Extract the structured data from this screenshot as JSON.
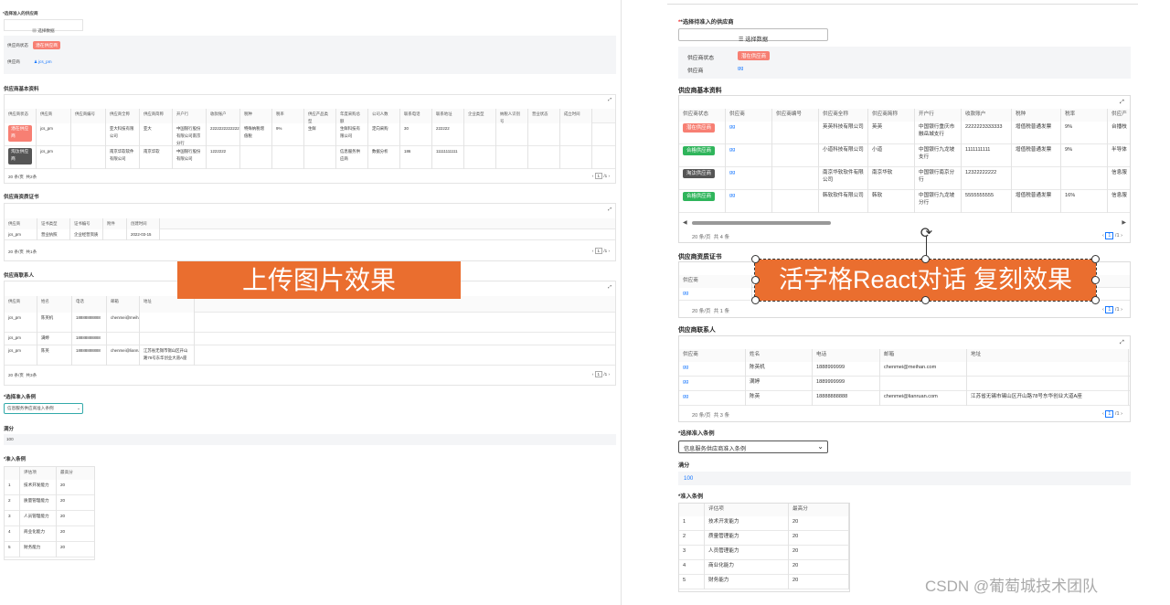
{
  "left": {
    "title": "*选择准入的供应商",
    "select_btn": "选择数据",
    "status_label": "供应商状态",
    "status_tag": "潜在供应商",
    "supplier_label": "供应商",
    "supplier_value": "jcs_pm",
    "basic_title": "供应商基本资料",
    "basic_headers": [
      "供应商状态",
      "供应商",
      "供应商编号",
      "供应商全称",
      "供应商简称",
      "开户行",
      "收款账户",
      "税种",
      "税率",
      "供应产品类型",
      "年度采购总额",
      "公司人数",
      "联系电话",
      "联系地址",
      "企业类型",
      "纳税人识别号",
      "营业状态",
      "成立时间"
    ],
    "basic_rows": [
      {
        "status": "潜在供应商",
        "supplier": "jcs_pm",
        "fullname": "亚大科技有限公司",
        "short": "亚大",
        "bank": "中国银行股份有限公司南京分行",
        "account": "2222222222222",
        "taxkind": "特殊纳税增值税",
        "rate": "9%",
        "ptype": "生鲜",
        "purchase": "生鲜科技有限公司",
        "type2": "定向采购",
        "people": "30",
        "phone": "222222"
      },
      {
        "status": "淘汰供应商",
        "supplier": "jcs_pm",
        "fullname": "南京华软软件有限公司",
        "short": "南京华软",
        "bank": "中国银行股份有限公司",
        "account": "1222222",
        "taxkind": "",
        "rate": "",
        "ptype": "",
        "purchase": "信息服务供应商",
        "type2": "数据分析",
        "people": "186",
        "phone": "11111111111"
      }
    ],
    "basic_pager": "20 条/页",
    "basic_total": "共2条",
    "cert_title": "供应商资质证书",
    "cert_headers": [
      "供应商",
      "证书类型",
      "证书编号",
      "附件",
      "创建时间"
    ],
    "cert_row": [
      "jcs_pm",
      "营业执照",
      "企业经营资质",
      "",
      "2022-03-15"
    ],
    "cert_pager": "20 条/页",
    "cert_total": "共1条",
    "contact_title": "供应商联系人",
    "contact_headers": [
      "供应商",
      "姓名",
      "电话",
      "邮箱",
      "地址"
    ],
    "contact_rows": [
      [
        "jcs_pm",
        "陈英机",
        "18888888888",
        "chenmei@meihan.com",
        ""
      ],
      [
        "jcs_pm",
        "满婷",
        "18888888888",
        "",
        ""
      ],
      [
        "jcs_pm",
        "陈英",
        "18888888888",
        "chenmei@lianruan.com",
        "江苏省无锡市锡山区开山路78号东华创业大道A座"
      ]
    ],
    "contact_pager": "20 条/页",
    "contact_total": "共3条",
    "cond_title": "*选择准入条例",
    "cond_value": "信息服务供应商准入条例",
    "score_label": "满分",
    "score_value": "100",
    "rule_title": "*准入条例",
    "rule_headers": [
      "评估项",
      "最高分"
    ],
    "rules": [
      {
        "idx": "1",
        "item": "技术开发能力",
        "score": "20"
      },
      {
        "idx": "2",
        "item": "质量管理能力",
        "score": "20"
      },
      {
        "idx": "3",
        "item": "人员管理能力",
        "score": "20"
      },
      {
        "idx": "4",
        "item": "商业化能力",
        "score": "20"
      },
      {
        "idx": "5",
        "item": "财务能力",
        "score": "20"
      }
    ]
  },
  "right": {
    "title": "*选择待准入的供应商",
    "select_btn": "选择数据",
    "status_label": "供应商状态",
    "status_tag": "潜在供应商",
    "supplier_label": "供应商",
    "supplier_value": "gg",
    "basic_title": "供应商基本资料",
    "basic_headers": [
      "供应商状态",
      "供应商",
      "供应商编号",
      "供应商全称",
      "供应商简称",
      "开户行",
      "收款账户",
      "税种",
      "税率",
      "供应产"
    ],
    "basic_rows": [
      {
        "status": "潜在供应商",
        "color": "#f77f73",
        "supplier": "gg",
        "fullname": "英英科技有限公司",
        "short": "英英",
        "bank": "中国银行重庆市融岳城支行",
        "account": "2222223333333",
        "taxkind": "增值税普通发票",
        "rate": "9%",
        "ptype": "台播枝"
      },
      {
        "status": "合格供应商",
        "color": "#2fb55b",
        "supplier": "gg",
        "fullname": "小道科技有限公司",
        "short": "小道",
        "bank": "中国银行九龙坡支行",
        "account": "1111111111",
        "taxkind": "增值税普通发票",
        "rate": "9%",
        "ptype": "半导体"
      },
      {
        "status": "淘汰供应商",
        "color": "#555555",
        "supplier": "gg",
        "fullname": "南京华软软件有限公司",
        "short": "南京华软",
        "bank": "中国银行南京分行",
        "account": "12322222222",
        "taxkind": "",
        "rate": "",
        "ptype": "信息服"
      },
      {
        "status": "合格供应商",
        "color": "#2fb55b",
        "supplier": "gg",
        "fullname": "韩软软件有限公司",
        "short": "韩软",
        "bank": "中国银行九龙坡分行",
        "account": "5555555555",
        "taxkind": "增值税普通发票",
        "rate": "16%",
        "ptype": "信息服"
      }
    ],
    "basic_pager": "20 条/页",
    "basic_total": "共 4 条",
    "cert_title": "供应商资质证书",
    "cert_headers": [
      "供应商"
    ],
    "cert_row": [
      "gg"
    ],
    "cert_pager": "20 条/页",
    "cert_total": "共 1 条",
    "contact_title": "供应商联系人",
    "contact_headers": [
      "供应商",
      "姓名",
      "电话",
      "邮箱",
      "地址"
    ],
    "contact_rows": [
      [
        "gg",
        "陈英机",
        "1888999999",
        "chenmei@meihan.com",
        ""
      ],
      [
        "gg",
        "满婷",
        "1889999999",
        "",
        ""
      ],
      [
        "gg",
        "陈英",
        "18888888888",
        "chenmei@lianruan.com",
        "江苏省无锡市锡山区开山路78号东华创业大道A座"
      ]
    ],
    "contact_pager": "20 条/页",
    "contact_total": "共 3 条",
    "cond_title": "*选择准入条例",
    "cond_value": "信息服务供应商准入条例",
    "score_label": "满分",
    "score_value": "100",
    "rule_title": "*准入条例",
    "rule_headers": [
      "评估项",
      "最高分"
    ],
    "rules": [
      {
        "idx": "1",
        "item": "技术开发能力",
        "score": "20"
      },
      {
        "idx": "2",
        "item": "质量管理能力",
        "score": "20"
      },
      {
        "idx": "3",
        "item": "人员管理能力",
        "score": "20"
      },
      {
        "idx": "4",
        "item": "商业化能力",
        "score": "20"
      },
      {
        "idx": "5",
        "item": "财务能力",
        "score": "20"
      }
    ],
    "page_num": "1"
  },
  "banner_left": "上传图片效果",
  "banner_right": "活字格React对话 复刻效果",
  "watermark": "CSDN @葡萄城技术团队"
}
